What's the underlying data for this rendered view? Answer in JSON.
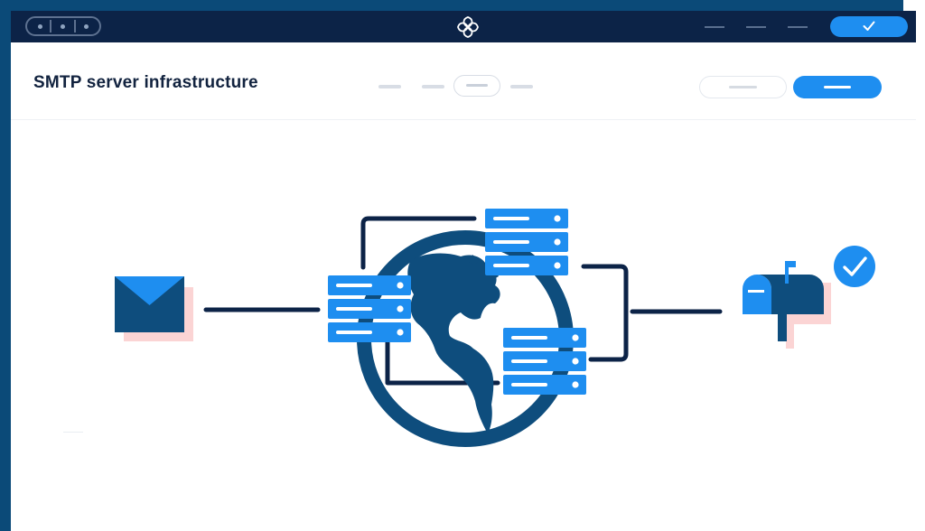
{
  "page": {
    "title": "SMTP server infrastructure"
  },
  "colors": {
    "frame": "#0b4a78",
    "titlebar": "#0c2347",
    "accent": "#1e8ef0",
    "dark_blue": "#0e4d7d",
    "navy_line": "#0c2347",
    "shadow_pink": "#fbd4d4"
  },
  "icons": {
    "window_controls": "traffic-dots",
    "logo": "swirl-logo-icon",
    "confirm": "checkmark-icon",
    "sender": "envelope-icon",
    "network": "globe-icon",
    "servers": "server-rack-icon",
    "recipient": "mailbox-icon",
    "delivered": "check-circle-icon"
  }
}
